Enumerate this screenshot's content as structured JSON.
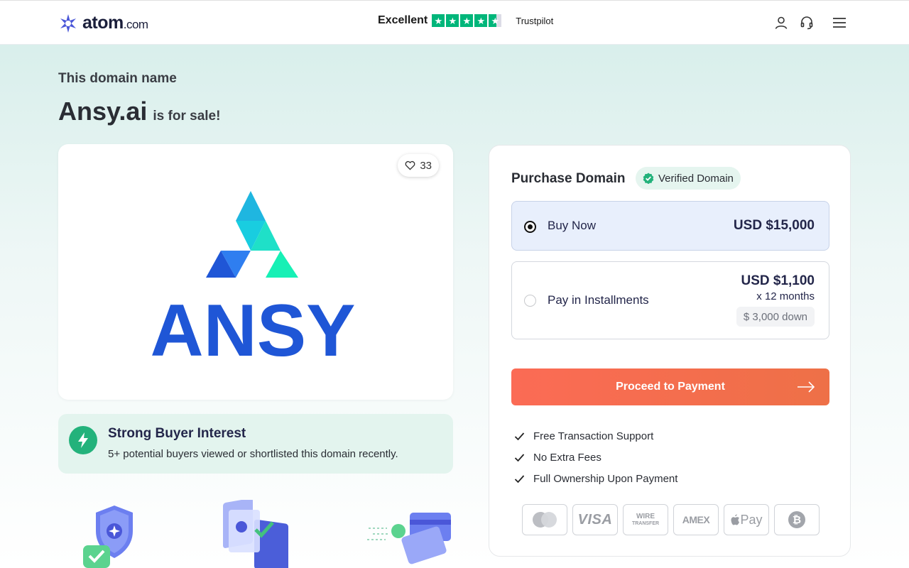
{
  "header": {
    "logo_text": "atom",
    "logo_suffix": ".com",
    "trustpilot": {
      "rating_label": "Excellent",
      "stars": 4.5,
      "name": "Trustpilot",
      "color": "#00b67a"
    },
    "icons": [
      "user-icon",
      "headset-icon",
      "hamburger-menu-icon"
    ]
  },
  "hero": {
    "subtitle": "This domain name",
    "domain": "Ansy.ai",
    "for_sale": "is for sale!"
  },
  "listing": {
    "likes": "33",
    "brand_wordmark": "ANSY",
    "brand_colors": [
      "#1f56d6",
      "#1fc6df",
      "#17e3b5"
    ]
  },
  "interest": {
    "title": "Strong Buyer Interest",
    "text": "5+ potential buyers viewed or shortlisted this domain recently."
  },
  "purchase": {
    "title": "Purchase Domain",
    "verified": "Verified Domain",
    "buy_now": {
      "label": "Buy Now",
      "price": "USD $15,000",
      "selected": true
    },
    "installments": {
      "label": "Pay in Installments",
      "price": "USD $1,100",
      "months": "x 12 months",
      "down": "$ 3,000 down",
      "selected": false
    },
    "proceed_label": "Proceed to Payment",
    "accent_color": "#f96a52",
    "features": [
      "Free Transaction Support",
      "No Extra Fees",
      "Full Ownership Upon Payment"
    ],
    "payment_methods": {
      "mastercard": "mastercard-icon",
      "visa": "VISA",
      "wire_line1": "WIRE",
      "wire_line2": "TRANSFER",
      "amex": "AMEX",
      "apple_pay": "Pay",
      "bitcoin": "₿"
    }
  }
}
